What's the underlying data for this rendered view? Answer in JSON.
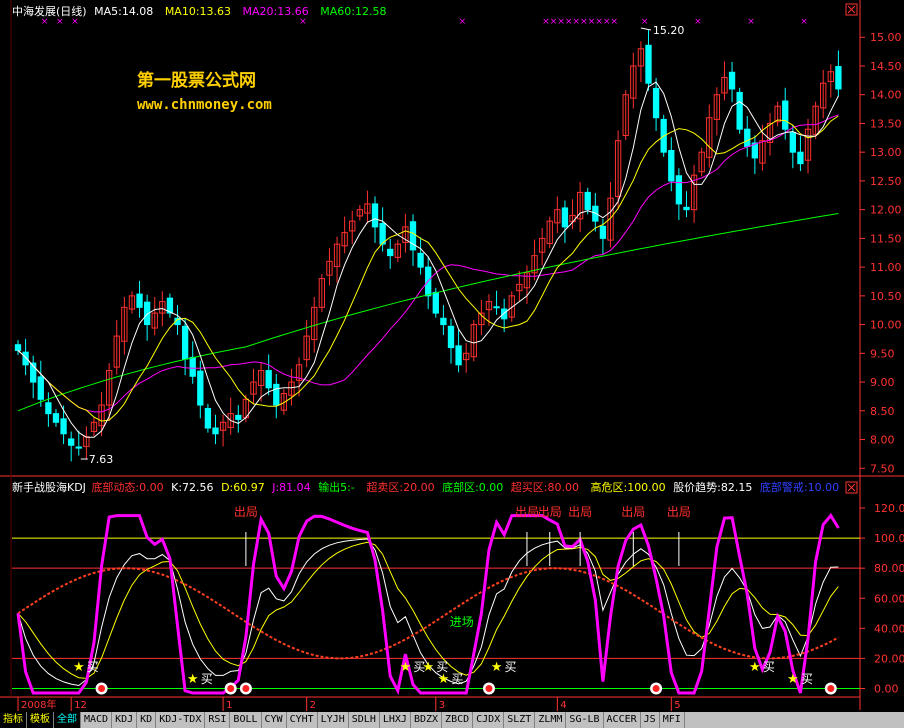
{
  "window": {
    "title": "中海发展(日线)"
  },
  "watermark": {
    "line1": "第一股票公式网",
    "line2": "www.chnmoney.com"
  },
  "colors": {
    "up": "#ff3030",
    "down": "#00ffff",
    "ma5": "#ffffff",
    "ma10": "#ffff00",
    "ma20": "#ff00ff",
    "ma60": "#00ff00",
    "grid": "#a00000",
    "axis": "#ff3333"
  },
  "main_header": [
    {
      "text": "MA5:14.08",
      "color": "#ffffff"
    },
    {
      "text": "MA10:13.63",
      "color": "#ffff00"
    },
    {
      "text": "MA20:13.66",
      "color": "#ff00ff"
    },
    {
      "text": "MA60:12.58",
      "color": "#00ff00"
    }
  ],
  "ind_header": [
    {
      "text": "新手战股海KDJ",
      "color": "#ffffff"
    },
    {
      "text": "底部动态:0.00",
      "color": "#ff3030"
    },
    {
      "text": "K:72.56",
      "color": "#ffffff"
    },
    {
      "text": "D:60.97",
      "color": "#ffff00"
    },
    {
      "text": "J:81.04",
      "color": "#ff00ff"
    },
    {
      "text": "输出5:-",
      "color": "#00ff00"
    },
    {
      "text": "超卖区:20.00",
      "color": "#ff3030"
    },
    {
      "text": "底部区:0.00",
      "color": "#00ff00"
    },
    {
      "text": "超买区:80.00",
      "color": "#ff3030"
    },
    {
      "text": "高危区:100.00",
      "color": "#ffff00"
    },
    {
      "text": "股价趋势:82.15",
      "color": "#ffffff"
    },
    {
      "text": "底部警戒:10.00",
      "color": "#3040ff"
    }
  ],
  "signals": {
    "buy": "买",
    "exit": "出局",
    "enter": "进场"
  },
  "time_axis": [
    {
      "label": "2008年",
      "day": 0
    },
    {
      "label": "12",
      "day": 7
    },
    {
      "label": "1",
      "day": 27
    },
    {
      "label": "2",
      "day": 38
    },
    {
      "label": "3",
      "day": 55
    },
    {
      "label": "4",
      "day": 71
    },
    {
      "label": "5",
      "day": 86
    }
  ],
  "tabs": {
    "items": [
      "指标",
      "模板",
      "全部",
      "MACD",
      "KDJ",
      "KD",
      "KDJ-TDX",
      "RSI",
      "BOLL",
      "CYW",
      "CYHT",
      "LYJH",
      "SDLH",
      "LHXJ",
      "BDZX",
      "ZBCD",
      "CJDX",
      "SLZT",
      "ZLMM",
      "SG-LB",
      "ACCER",
      "JS",
      "MFI"
    ],
    "active": 2
  },
  "chart_data": [
    {
      "type": "candlestick",
      "title": "中海发展(日线)",
      "ylim": [
        7.4,
        15.3
      ],
      "yticks": [
        "7.50",
        "8.00",
        "8.50",
        "9.00",
        "9.50",
        "10.00",
        "10.50",
        "11.00",
        "11.50",
        "12.00",
        "12.50",
        "13.00",
        "13.50",
        "14.00",
        "14.50",
        "15.00"
      ],
      "high_label": "15.20",
      "low_label": "7.63",
      "close": [
        9.55,
        9.3,
        9.0,
        8.7,
        8.45,
        8.3,
        8.1,
        7.9,
        7.85,
        8.05,
        8.3,
        8.6,
        9.2,
        9.8,
        10.3,
        10.5,
        10.3,
        10.0,
        10.2,
        10.4,
        10.2,
        10.0,
        9.4,
        9.1,
        8.6,
        8.2,
        8.1,
        8.3,
        8.45,
        8.35,
        8.7,
        9.0,
        9.2,
        8.9,
        8.6,
        8.8,
        9.0,
        9.3,
        9.8,
        10.3,
        10.8,
        11.1,
        11.4,
        11.6,
        11.8,
        12.0,
        12.1,
        11.7,
        11.4,
        11.2,
        11.4,
        11.7,
        11.3,
        11.0,
        10.5,
        10.2,
        10.0,
        9.6,
        9.3,
        9.5,
        10.0,
        10.2,
        10.4,
        10.3,
        10.1,
        10.5,
        10.7,
        10.9,
        11.2,
        11.5,
        11.8,
        12.0,
        11.7,
        11.9,
        12.3,
        12.0,
        11.8,
        11.5,
        12.2,
        13.2,
        14.0,
        14.5,
        14.8,
        14.2,
        13.6,
        13.0,
        12.5,
        12.1,
        12.0,
        12.6,
        13.0,
        13.6,
        14.0,
        14.3,
        14.1,
        13.4,
        13.1,
        12.9,
        13.2,
        13.5,
        13.8,
        13.4,
        13.0,
        12.8,
        13.4,
        13.8,
        14.2,
        14.4,
        14.1
      ],
      "ma5": [
        9.55,
        9.43,
        9.28,
        9.14,
        9.0,
        8.75,
        8.51,
        8.29,
        8.12,
        8.04,
        8.04,
        8.15,
        8.4,
        8.79,
        9.25,
        9.68,
        10.02,
        10.18,
        10.26,
        10.28,
        10.22,
        10.16,
        10.04,
        9.82,
        9.46,
        9.06,
        8.68,
        8.46,
        8.33,
        8.28,
        8.38,
        8.56,
        8.74,
        8.83,
        8.88,
        8.9,
        8.9,
        8.92,
        9.1,
        9.34,
        9.78,
        10.2,
        10.68,
        11.04,
        11.34,
        11.58,
        11.78,
        11.84,
        11.8,
        11.68,
        11.56,
        11.48,
        11.4,
        11.32,
        11.18,
        10.94,
        10.6,
        10.26,
        9.92,
        9.72,
        9.68,
        9.72,
        9.88,
        10.08,
        10.2,
        10.3,
        10.4,
        10.5,
        10.68,
        10.96,
        11.22,
        11.48,
        11.64,
        11.78,
        11.94,
        11.98,
        11.94,
        11.86,
        11.96,
        12.14,
        12.54,
        13.08,
        13.74,
        14.14,
        14.22,
        14.02,
        13.62,
        13.08,
        12.64,
        12.44,
        12.44,
        12.64,
        13.04,
        13.5,
        13.8,
        13.88,
        13.78,
        13.56,
        13.34,
        13.22,
        13.3,
        13.34,
        13.36,
        13.3,
        13.28,
        13.28,
        13.44,
        13.72,
        13.98
      ],
      "ma10": [
        9.55,
        9.43,
        9.28,
        9.14,
        9.0,
        8.88,
        8.77,
        8.66,
        8.56,
        8.51,
        8.39,
        8.32,
        8.34,
        8.46,
        8.62,
        8.86,
        9.08,
        9.28,
        9.52,
        9.76,
        9.95,
        10.09,
        10.11,
        10.04,
        9.87,
        9.64,
        9.42,
        9.25,
        9.08,
        8.87,
        8.72,
        8.62,
        8.6,
        8.58,
        8.58,
        8.64,
        8.73,
        8.83,
        8.97,
        9.11,
        9.34,
        9.55,
        9.81,
        10.08,
        10.38,
        10.68,
        10.99,
        11.26,
        11.42,
        11.52,
        11.57,
        11.63,
        11.59,
        11.5,
        11.43,
        11.25,
        11.04,
        10.83,
        10.62,
        10.45,
        10.31,
        10.16,
        10.05,
        9.98,
        9.94,
        9.97,
        10.0,
        10.06,
        10.25,
        10.5,
        10.76,
        10.99,
        11.12,
        11.24,
        11.42,
        11.57,
        11.68,
        11.74,
        11.85,
        12.02,
        12.26,
        12.51,
        12.82,
        13.05,
        13.18,
        13.28,
        13.35,
        13.41,
        13.39,
        13.33,
        13.23,
        13.09,
        12.97,
        12.99,
        13.06,
        13.14,
        13.2,
        13.26,
        13.38,
        13.48,
        13.56,
        13.55,
        13.47,
        13.32,
        13.25,
        13.28,
        13.39,
        13.54,
        13.63
      ],
      "ma20": [
        9.55,
        9.43,
        9.28,
        9.14,
        9.0,
        8.88,
        8.77,
        8.66,
        8.56,
        8.51,
        8.48,
        8.48,
        8.53,
        8.63,
        8.76,
        8.88,
        8.98,
        9.05,
        9.13,
        9.2,
        9.24,
        9.27,
        9.25,
        9.24,
        9.24,
        9.25,
        9.25,
        9.27,
        9.3,
        9.31,
        9.33,
        9.35,
        9.34,
        9.3,
        9.21,
        9.14,
        9.09,
        9.07,
        9.03,
        8.98,
        8.95,
        8.95,
        8.99,
        9.04,
        9.17,
        9.32,
        9.47,
        9.61,
        9.76,
        9.92,
        10.06,
        10.22,
        10.4,
        10.59,
        10.76,
        10.9,
        11.0,
        11.04,
        11.03,
        11.0,
        10.96,
        10.94,
        10.91,
        10.88,
        10.87,
        10.85,
        10.85,
        10.84,
        10.84,
        10.86,
        10.88,
        10.9,
        10.92,
        10.95,
        11.04,
        11.13,
        11.2,
        11.22,
        11.29,
        11.43,
        11.61,
        11.8,
        12.04,
        12.22,
        12.34,
        12.42,
        12.48,
        12.47,
        12.47,
        12.51,
        12.55,
        12.62,
        12.7,
        12.85,
        12.96,
        13.04,
        13.09,
        13.14,
        13.18,
        13.21,
        13.26,
        13.34,
        13.43,
        13.47,
        13.48,
        13.48,
        13.53,
        13.6,
        13.65
      ]
    },
    {
      "type": "line",
      "title": "新手战股海KDJ",
      "ylim": [
        -5,
        130
      ],
      "yticks": [
        "0.00",
        "20.00",
        "40.00",
        "60.00",
        "80.00",
        "100.00",
        "120.00"
      ],
      "hlines": [
        {
          "value": 100,
          "color": "#ffff00"
        },
        {
          "value": 80,
          "color": "#ff3030"
        },
        {
          "value": 20,
          "color": "#ff3030"
        },
        {
          "value": 0,
          "color": "#00ff00"
        }
      ],
      "exit_days": [
        30,
        67,
        70,
        74,
        81,
        87
      ],
      "enter_day": 55,
      "buy_days": [
        8,
        23,
        51,
        54,
        56,
        63,
        97,
        102
      ],
      "circle_days": [
        11,
        28,
        30,
        62,
        84,
        107
      ]
    }
  ]
}
